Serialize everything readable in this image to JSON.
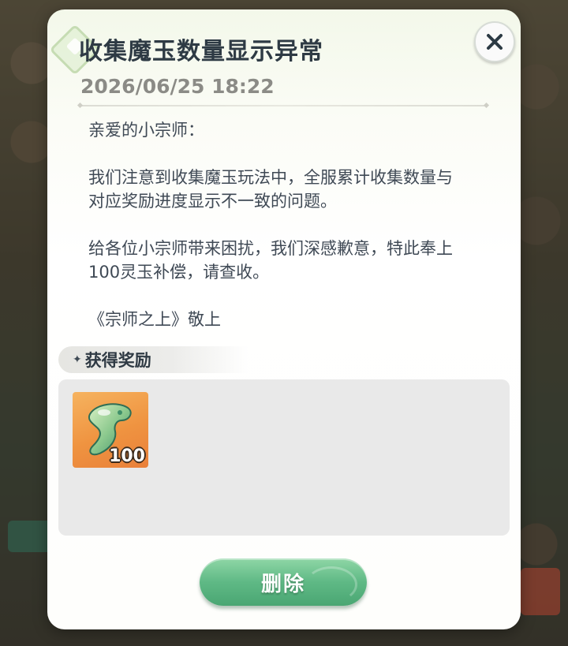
{
  "mail": {
    "title": "收集魔玉数量显示异常",
    "timestamp": "2026/06/25 18:22",
    "paragraphs": [
      "亲爱的小宗师：",
      "我们注意到收集魔玉玩法中，全服累计收集数量与\n对应奖励进度显示不一致的问题。",
      "给各位小宗师带来困扰，我们深感歉意，特此奉上\n100灵玉补偿，请查收。",
      "《宗师之上》敬上"
    ]
  },
  "rewards": {
    "header": "获得奖励",
    "header_icon": "sparkle-icon",
    "items": [
      {
        "icon": "jade-item-icon",
        "quantity": "100"
      }
    ]
  },
  "actions": {
    "delete_label": "删除",
    "close_icon": "close-icon"
  },
  "colors": {
    "title": "#2e3a44",
    "button_green": "#5fb985",
    "item_bg_orange": "#ef9340"
  }
}
